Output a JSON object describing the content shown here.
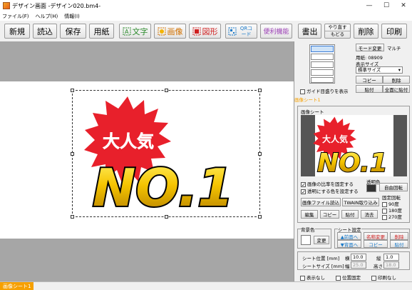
{
  "window": {
    "title": "デザイン画面 -デザイン020.bm4-",
    "minimize": "—",
    "maximize": "☐",
    "close": "✕"
  },
  "menu": [
    "ファイル(F)",
    "ヘルプ(H)",
    "情報(I)"
  ],
  "toolbar": {
    "new": "新規",
    "open": "読込",
    "save": "保存",
    "paper": "用紙",
    "text": "文字",
    "image": "画像",
    "shape": "図形",
    "qr": "QRコード",
    "util": "便利機能",
    "print_out": "書出",
    "redo": "やり直す",
    "undo": "もどる",
    "delete": "削除",
    "print": "印刷"
  },
  "artwork": {
    "badge_text": "大人気",
    "main_text": "NO.1"
  },
  "layout_panel": {
    "mode_change": "モード変更",
    "multi": "マルチ",
    "paper_label": "用紙: 08909",
    "display_size_label": "表示サイズ",
    "display_size_value": "標準サイズ",
    "copy": "コピー",
    "delete": "削除",
    "paste": "貼付",
    "paste_all": "全面に貼付",
    "guide_print": "ガイド目盛りを表示"
  },
  "sheet_header": "画像シート1",
  "image_sheet": {
    "title": "画像シート",
    "transparent_color": "透明色",
    "keep_ratio": "画像の比率を固定する",
    "set_transparent": "透明にする色を設定する",
    "free_rotate": "自由回転",
    "fixed_rotate": "固定回転",
    "rot90": "90度",
    "rot180": "180度",
    "rot270": "270度",
    "load_file": "画像ファイル読込",
    "twain": "TWAIN取り込み",
    "edit": "編集",
    "copy": "コピー",
    "paste": "貼付",
    "erase": "消去"
  },
  "bg": {
    "title": "背景色",
    "change": "変更"
  },
  "sheet_settings": {
    "title": "シート設定",
    "front": "▲前面へ",
    "back": "▼背面へ",
    "rename": "名称変更",
    "copy": "コピー",
    "delete": "削除",
    "paste": "貼付"
  },
  "position": {
    "pos_label": "シート位置 [mm]",
    "x_label": "横",
    "x_value": "10.0",
    "y_label": "縦",
    "y_value": "1.0",
    "size_label": "シートサイズ [mm]",
    "w_label": "幅",
    "w_value": "25.0",
    "h_label": "高さ",
    "h_value": "18.0"
  },
  "flags": {
    "hide": "表示なし",
    "fix_pos": "位置固定",
    "no_print": "印刷なし"
  },
  "status": {
    "tab": "画像シート1"
  },
  "colors": {
    "accent": "#f6a000",
    "star": "#e8202b",
    "gold": "#f5c400"
  }
}
